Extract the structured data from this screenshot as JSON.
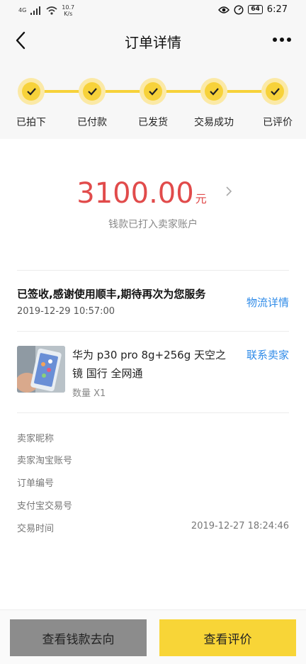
{
  "status_bar": {
    "network": "4G",
    "speed": "10.7",
    "speed_unit": "K/s",
    "battery": "64",
    "time": "6:27"
  },
  "header": {
    "title": "订单详情"
  },
  "steps": [
    {
      "label": "已拍下"
    },
    {
      "label": "已付款"
    },
    {
      "label": "已发货"
    },
    {
      "label": "交易成功"
    },
    {
      "label": "已评价"
    }
  ],
  "amount": {
    "value": "3100.00",
    "unit": "元",
    "note": "钱款已打入卖家账户"
  },
  "logistics": {
    "status": "已签收,感谢使用顺丰,期待再次为您服务",
    "time": "2019-12-29 10:57:00",
    "link": "物流详情"
  },
  "product": {
    "title": "华为 p30 pro 8g+256g 天空之镜 国行 全网通",
    "quantity": "数量 X1",
    "link": "联系卖家"
  },
  "info": {
    "seller_nick": "卖家昵称",
    "seller_account": "卖家淘宝账号",
    "order_no": "订单编号",
    "alipay_no": "支付宝交易号",
    "trade_time_label": "交易时间",
    "trade_time_value": "2019-12-27 18:24:46"
  },
  "actions": {
    "money_flow": "查看钱款去向",
    "view_review": "查看评价"
  },
  "colors": {
    "accent_yellow": "#f7d23a",
    "price_red": "#e14b4b",
    "link_blue": "#2f8be8",
    "gray_button": "#8c8c8c"
  }
}
